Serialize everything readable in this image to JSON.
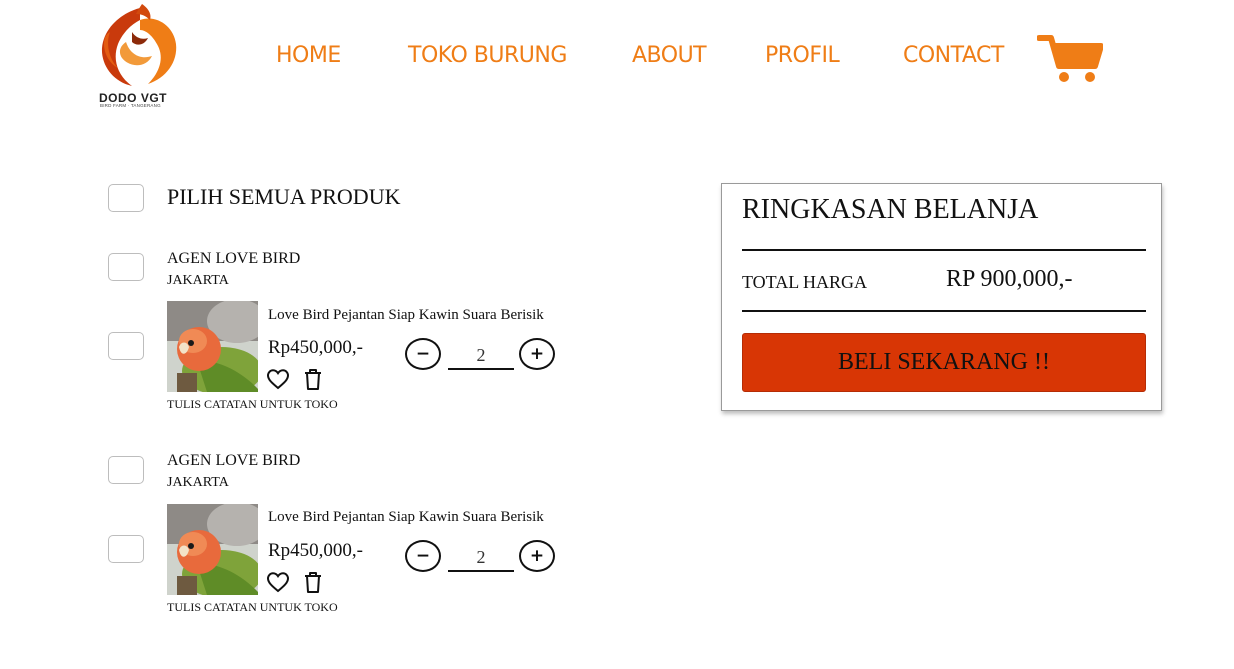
{
  "brand": {
    "name": "DODO VGT",
    "tagline": "BIRD FARM · TANGERANG"
  },
  "nav": {
    "home": "HOME",
    "toko_burung": "TOKO BURUNG",
    "about": "ABOUT",
    "profil": "PROFIL",
    "contact": "CONTACT"
  },
  "cart_icon": "shopping-cart",
  "colors": {
    "accent": "#ef7d16",
    "buy_button": "#d83605"
  },
  "select_all_label": "PILIH SEMUA PRODUK",
  "cart_groups": [
    {
      "shop_name": "AGEN LOVE BIRD",
      "shop_city": "JAKARTA",
      "product": {
        "name": "Love Bird Pejantan Siap Kawin Suara Berisik",
        "price": "Rp450,000,-",
        "quantity": "2",
        "minus": "−",
        "plus": "+"
      },
      "note_label": "TULIS CATATAN UNTUK TOKO"
    },
    {
      "shop_name": "AGEN LOVE BIRD",
      "shop_city": "JAKARTA",
      "product": {
        "name": "Love Bird Pejantan Siap Kawin Suara Berisik",
        "price": "Rp450,000,-",
        "quantity": "2",
        "minus": "−",
        "plus": "+"
      },
      "note_label": "TULIS CATATAN UNTUK TOKO"
    }
  ],
  "summary": {
    "title": "RINGKASAN BELANJA",
    "total_label": "TOTAL HARGA",
    "total_value": "RP 900,000,-",
    "buy_label": "BELI SEKARANG !!"
  }
}
